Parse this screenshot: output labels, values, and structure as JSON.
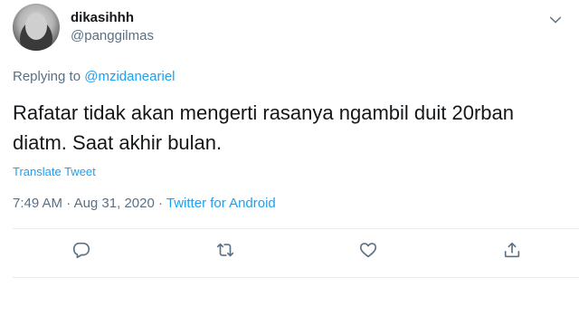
{
  "user": {
    "display_name": "dikasihhh",
    "handle": "@panggilmas"
  },
  "reply": {
    "prefix": "Replying to",
    "mention": "@mzidaneariel"
  },
  "tweet": {
    "text": "Rafatar tidak akan mengerti rasanya ngambil duit 20rban diatm. Saat akhir bulan.",
    "translate_label": "Translate Tweet",
    "time": "7:49 AM",
    "separator": "·",
    "date": "Aug 31, 2020",
    "source": "Twitter for Android"
  },
  "actions": {
    "reply_icon": "reply-icon",
    "retweet_icon": "retweet-icon",
    "like_icon": "like-icon",
    "share_icon": "share-icon"
  },
  "colors": {
    "accent": "#1da1f2",
    "muted": "#5b7083",
    "text": "#14171a"
  }
}
